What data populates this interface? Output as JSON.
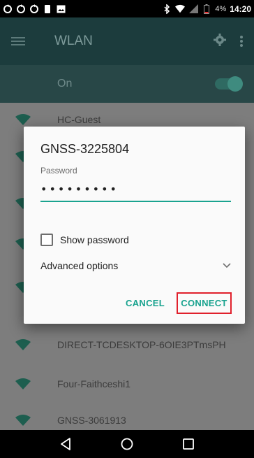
{
  "status_bar": {
    "battery_text": "4%",
    "time": "14:20",
    "left_icons": [
      "sync-icon",
      "sync-icon",
      "sync-icon",
      "sim-icon",
      "image-icon"
    ],
    "right_icons": [
      "bluetooth-icon",
      "wifi-icon",
      "no-signal-icon",
      "battery-icon"
    ]
  },
  "toolbar": {
    "title": "WLAN"
  },
  "switch_bar": {
    "label": "On",
    "state": "on"
  },
  "networks": [
    {
      "ssid": "HC-Guest"
    },
    {
      "ssid": "DIRECT-TCDESKTOP-6OIE3PTmsPH"
    },
    {
      "ssid": "Four-Faithceshi1"
    },
    {
      "ssid": "GNSS-3061913"
    }
  ],
  "dialog": {
    "title": "GNSS-3225804",
    "password_label": "Password",
    "password_value": "•••••••••",
    "show_password_label": "Show password",
    "show_password_checked": false,
    "advanced_label": "Advanced options",
    "cancel_label": "CANCEL",
    "connect_label": "CONNECT"
  },
  "colors": {
    "accent": "#1aa38f",
    "highlight": "#e0202c"
  }
}
